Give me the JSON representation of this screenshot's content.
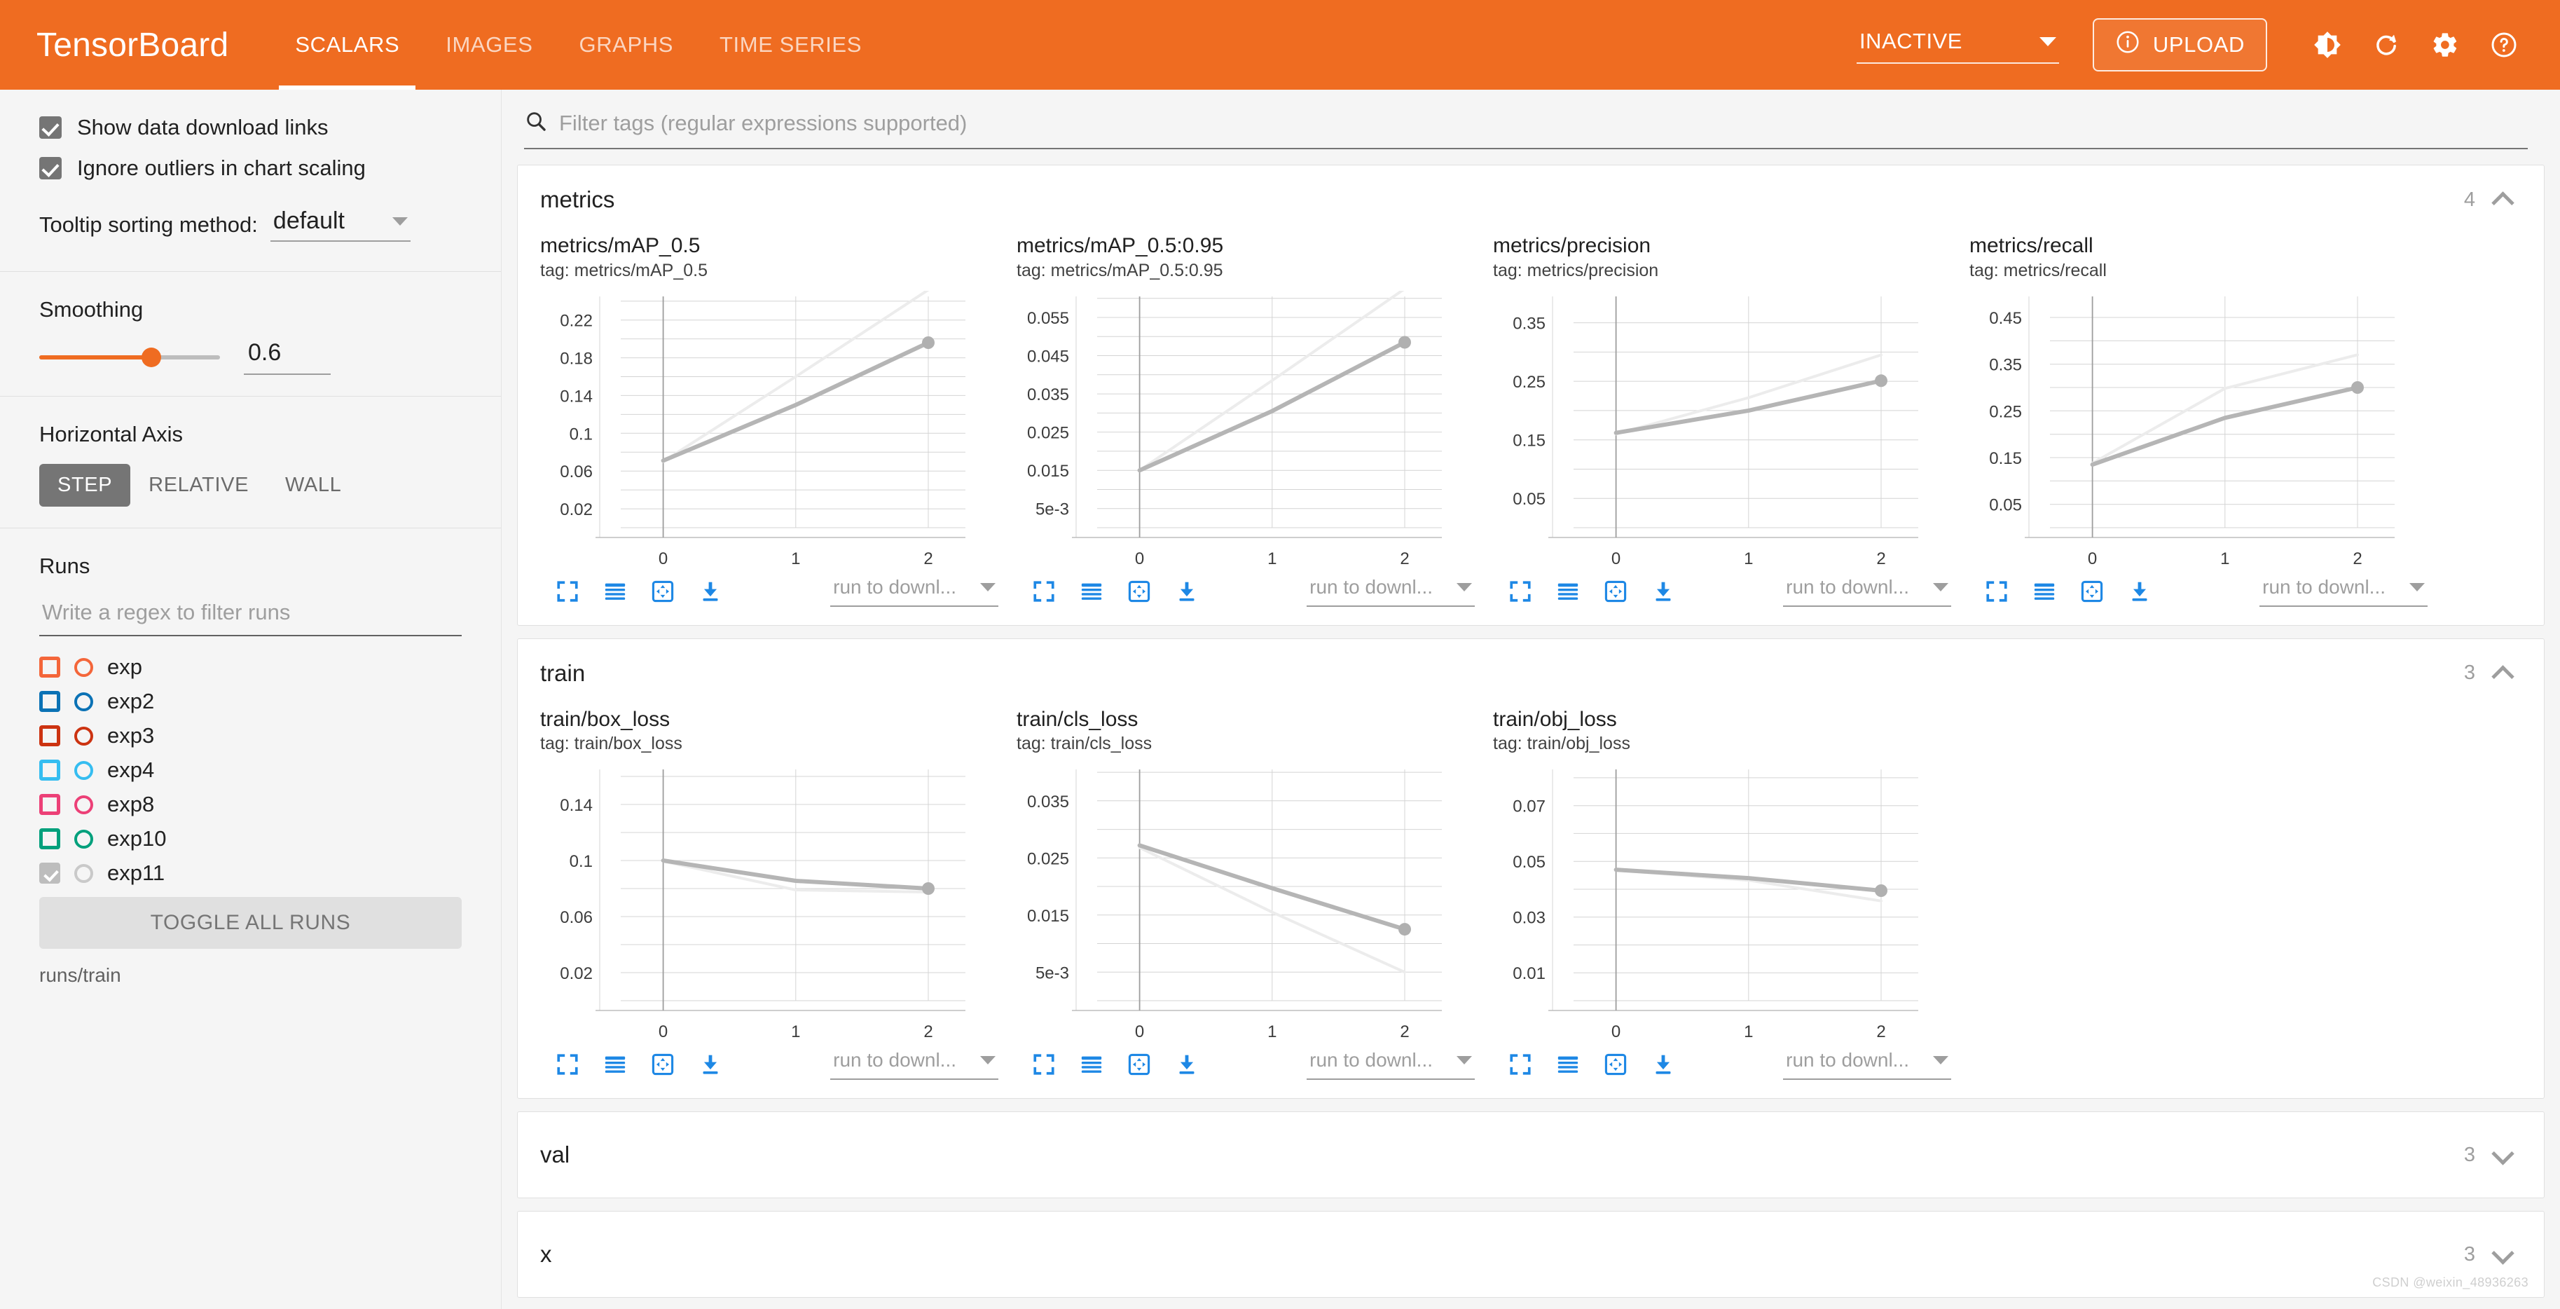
{
  "header": {
    "brand": "TensorBoard",
    "tabs": [
      {
        "label": "SCALARS",
        "active": true
      },
      {
        "label": "IMAGES",
        "active": false
      },
      {
        "label": "GRAPHS",
        "active": false
      },
      {
        "label": "TIME SERIES",
        "active": false
      }
    ],
    "status_select": "INACTIVE",
    "upload_label": "UPLOAD",
    "icons": [
      "info-icon",
      "brightness-icon",
      "refresh-icon",
      "gear-icon",
      "help-icon"
    ],
    "accent_color": "#ef6c21"
  },
  "sidebar": {
    "checkboxes": [
      {
        "label": "Show data download links",
        "checked": true
      },
      {
        "label": "Ignore outliers in chart scaling",
        "checked": true
      }
    ],
    "tooltip_sort": {
      "label": "Tooltip sorting method:",
      "value": "default"
    },
    "smoothing": {
      "title": "Smoothing",
      "value": "0.6",
      "percent": 62
    },
    "horizontal_axis": {
      "title": "Horizontal Axis",
      "options": [
        {
          "label": "STEP",
          "active": true
        },
        {
          "label": "RELATIVE",
          "active": false
        },
        {
          "label": "WALL",
          "active": false
        }
      ]
    },
    "runs": {
      "title": "Runs",
      "filter_placeholder": "Write a regex to filter runs",
      "items": [
        {
          "label": "exp",
          "color": "#f4663a",
          "checked": false
        },
        {
          "label": "exp2",
          "color": "#0b72b5",
          "checked": false
        },
        {
          "label": "exp3",
          "color": "#cc3311",
          "checked": false
        },
        {
          "label": "exp4",
          "color": "#35bdf0",
          "checked": false
        },
        {
          "label": "exp8",
          "color": "#ec4077",
          "checked": false
        },
        {
          "label": "exp10",
          "color": "#00a07c",
          "checked": false
        },
        {
          "label": "exp11",
          "color": "#bdbdbd",
          "checked": true
        }
      ],
      "toggle_all_label": "TOGGLE ALL RUNS",
      "active_path": "runs/train"
    }
  },
  "filter": {
    "placeholder": "Filter tags (regular expressions supported)",
    "icon": "search-icon"
  },
  "chart_toolbar": {
    "icons": [
      "fullscreen-icon",
      "data-table-icon",
      "fit-domain-icon",
      "download-icon"
    ],
    "run_select_label": "run to downl..."
  },
  "sections": [
    {
      "name": "metrics",
      "count": "4",
      "expanded": true
    },
    {
      "name": "train",
      "count": "3",
      "expanded": true
    },
    {
      "name": "val",
      "count": "3",
      "expanded": false
    },
    {
      "name": "x",
      "count": "3",
      "expanded": false
    }
  ],
  "watermark": "CSDN @weixin_48936263",
  "chart_data": [
    {
      "type": "line",
      "title": "metrics/mAP_0.5",
      "tag": "tag: metrics/mAP_0.5",
      "section": "metrics",
      "xlabel": "",
      "ylabel": "",
      "x": [
        0,
        1,
        2
      ],
      "xticks": [
        "0",
        "1",
        "2"
      ],
      "xlim": [
        -0.32,
        2.28
      ],
      "yticks": [
        "0.02",
        "0.06",
        "0.1",
        "0.14",
        "0.18",
        "0.22"
      ],
      "ytickvals": [
        0.02,
        0.06,
        0.1,
        0.14,
        0.18,
        0.22
      ],
      "ylim": [
        0.0,
        0.245
      ],
      "grid": true,
      "series": [
        {
          "name": "exp11 (smoothed)",
          "color": "#b5b5b5",
          "width": 6,
          "values": [
            0.071,
            0.13,
            0.196
          ]
        },
        {
          "name": "exp11 (raw)",
          "color": "#ececec",
          "width": 4,
          "values": [
            0.07,
            0.16,
            0.252
          ]
        }
      ]
    },
    {
      "type": "line",
      "title": "metrics/mAP_0.5:0.95",
      "tag": "tag: metrics/mAP_0.5:0.95",
      "section": "metrics",
      "xlabel": "",
      "ylabel": "",
      "x": [
        0,
        1,
        2
      ],
      "xticks": [
        "0",
        "1",
        "2"
      ],
      "xlim": [
        -0.32,
        2.28
      ],
      "yticks": [
        "5e-3",
        "0.015",
        "0.025",
        "0.035",
        "0.045",
        "0.055"
      ],
      "ytickvals": [
        0.005,
        0.015,
        0.025,
        0.035,
        0.045,
        0.055
      ],
      "ylim": [
        0.0,
        0.0605
      ],
      "grid": true,
      "series": [
        {
          "name": "exp11 (smoothed)",
          "color": "#b5b5b5",
          "width": 6,
          "values": [
            0.015,
            0.0305,
            0.0485
          ]
        },
        {
          "name": "exp11 (raw)",
          "color": "#ececec",
          "width": 4,
          "values": [
            0.015,
            0.0385,
            0.0625
          ]
        }
      ]
    },
    {
      "type": "line",
      "title": "metrics/precision",
      "tag": "tag: metrics/precision",
      "section": "metrics",
      "xlabel": "",
      "ylabel": "",
      "x": [
        0,
        1,
        2
      ],
      "xticks": [
        "0",
        "1",
        "2"
      ],
      "xlim": [
        -0.32,
        2.28
      ],
      "yticks": [
        "0.05",
        "0.15",
        "0.25",
        "0.35"
      ],
      "ytickvals": [
        0.05,
        0.15,
        0.25,
        0.35
      ],
      "ylim": [
        0.0,
        0.395
      ],
      "grid": true,
      "series": [
        {
          "name": "exp11 (smoothed)",
          "color": "#b5b5b5",
          "width": 6,
          "values": [
            0.162,
            0.2,
            0.251
          ]
        },
        {
          "name": "exp11 (raw)",
          "color": "#ececec",
          "width": 4,
          "values": [
            0.16,
            0.222,
            0.295
          ]
        }
      ]
    },
    {
      "type": "line",
      "title": "metrics/recall",
      "tag": "tag: metrics/recall",
      "section": "metrics",
      "xlabel": "",
      "ylabel": "",
      "x": [
        0,
        1,
        2
      ],
      "xticks": [
        "0",
        "1",
        "2"
      ],
      "xlim": [
        -0.32,
        2.28
      ],
      "yticks": [
        "0.05",
        "0.15",
        "0.25",
        "0.35",
        "0.45"
      ],
      "ytickvals": [
        0.05,
        0.15,
        0.25,
        0.35,
        0.45
      ],
      "ylim": [
        0.0,
        0.495
      ],
      "grid": true,
      "series": [
        {
          "name": "exp11 (smoothed)",
          "color": "#b5b5b5",
          "width": 6,
          "values": [
            0.135,
            0.235,
            0.3
          ]
        },
        {
          "name": "exp11 (raw)",
          "color": "#ececec",
          "width": 4,
          "values": [
            0.138,
            0.298,
            0.37
          ]
        }
      ]
    },
    {
      "type": "line",
      "title": "train/box_loss",
      "tag": "tag: train/box_loss",
      "section": "train",
      "xlabel": "",
      "ylabel": "",
      "x": [
        0,
        1,
        2
      ],
      "xticks": [
        "0",
        "1",
        "2"
      ],
      "xlim": [
        -0.32,
        2.28
      ],
      "yticks": [
        "0.02",
        "0.06",
        "0.1",
        "0.14"
      ],
      "ytickvals": [
        0.02,
        0.06,
        0.1,
        0.14
      ],
      "ylim": [
        0.0,
        0.165
      ],
      "grid": true,
      "series": [
        {
          "name": "exp11 (smoothed)",
          "color": "#b5b5b5",
          "width": 6,
          "values": [
            0.1,
            0.0855,
            0.08
          ]
        },
        {
          "name": "exp11 (raw)",
          "color": "#ececec",
          "width": 4,
          "values": [
            0.0995,
            0.079,
            0.0775
          ]
        }
      ]
    },
    {
      "type": "line",
      "title": "train/cls_loss",
      "tag": "tag: train/cls_loss",
      "section": "train",
      "xlabel": "",
      "ylabel": "",
      "x": [
        0,
        1,
        2
      ],
      "xticks": [
        "0",
        "1",
        "2"
      ],
      "xlim": [
        -0.32,
        2.28
      ],
      "yticks": [
        "5e-3",
        "0.015",
        "0.025",
        "0.035"
      ],
      "ytickvals": [
        0.005,
        0.015,
        0.025,
        0.035
      ],
      "ylim": [
        0.0,
        0.0405
      ],
      "grid": true,
      "series": [
        {
          "name": "exp11 (smoothed)",
          "color": "#b5b5b5",
          "width": 6,
          "values": [
            0.0272,
            0.0197,
            0.0125
          ]
        },
        {
          "name": "exp11 (raw)",
          "color": "#ececec",
          "width": 4,
          "values": [
            0.0268,
            0.0155,
            0.005
          ]
        }
      ]
    },
    {
      "type": "line",
      "title": "train/obj_loss",
      "tag": "tag: train/obj_loss",
      "section": "train",
      "xlabel": "",
      "ylabel": "",
      "x": [
        0,
        1,
        2
      ],
      "xticks": [
        "0",
        "1",
        "2"
      ],
      "xlim": [
        -0.32,
        2.28
      ],
      "yticks": [
        "0.01",
        "0.03",
        "0.05",
        "0.07"
      ],
      "ytickvals": [
        0.01,
        0.03,
        0.05,
        0.07
      ],
      "ylim": [
        0.0,
        0.083
      ],
      "grid": true,
      "series": [
        {
          "name": "exp11 (smoothed)",
          "color": "#b5b5b5",
          "width": 6,
          "values": [
            0.047,
            0.044,
            0.0395
          ]
        },
        {
          "name": "exp11 (raw)",
          "color": "#ececec",
          "width": 4,
          "values": [
            0.0468,
            0.0432,
            0.0358
          ]
        }
      ]
    }
  ]
}
